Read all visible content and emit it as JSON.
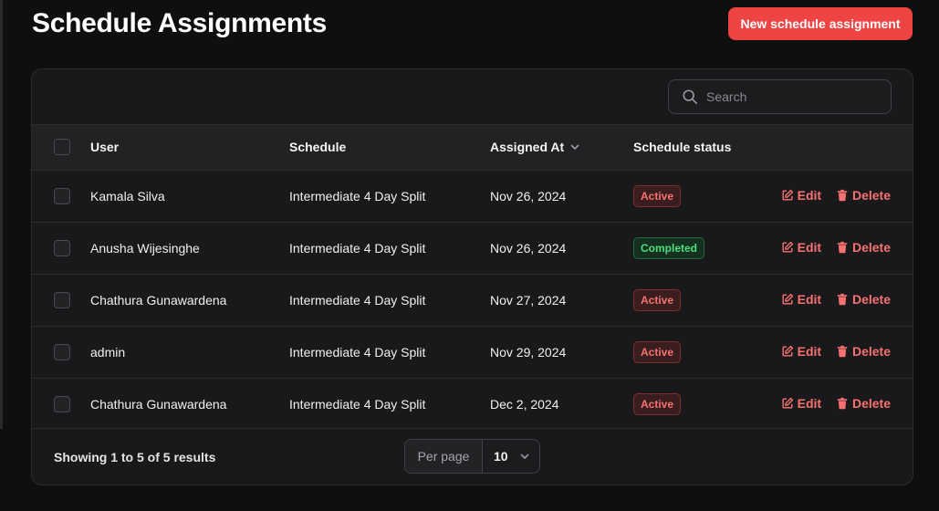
{
  "page": {
    "title": "Schedule Assignments",
    "new_button_label": "New schedule assignment"
  },
  "search": {
    "placeholder": "Search",
    "value": ""
  },
  "table": {
    "headers": {
      "user": "User",
      "schedule": "Schedule",
      "assigned_at": "Assigned At",
      "status": "Schedule status"
    },
    "rows": [
      {
        "user": "Kamala Silva",
        "schedule": "Intermediate 4 Day Split",
        "assigned_at": "Nov 26, 2024",
        "status": "Active",
        "edit": "Edit",
        "delete": "Delete"
      },
      {
        "user": "Anusha Wijesinghe",
        "schedule": "Intermediate 4 Day Split",
        "assigned_at": "Nov 26, 2024",
        "status": "Completed",
        "edit": "Edit",
        "delete": "Delete"
      },
      {
        "user": "Chathura Gunawardena",
        "schedule": "Intermediate 4 Day Split",
        "assigned_at": "Nov 27, 2024",
        "status": "Active",
        "edit": "Edit",
        "delete": "Delete"
      },
      {
        "user": "admin",
        "schedule": "Intermediate 4 Day Split",
        "assigned_at": "Nov 29, 2024",
        "status": "Active",
        "edit": "Edit",
        "delete": "Delete"
      },
      {
        "user": "Chathura Gunawardena",
        "schedule": "Intermediate 4 Day Split",
        "assigned_at": "Dec 2, 2024",
        "status": "Active",
        "edit": "Edit",
        "delete": "Delete"
      }
    ]
  },
  "footer": {
    "showing": "Showing 1 to 5 of 5 results",
    "per_page_label": "Per page",
    "per_page_value": "10"
  },
  "icons": {
    "search": "search-icon",
    "sort": "chevron-down-icon",
    "edit": "edit-icon",
    "delete": "trash-icon",
    "select": "chevron-down-icon"
  },
  "colors": {
    "accent": "#ef4444",
    "active_badge": "#f87171",
    "completed_badge": "#4ade80",
    "background": "#0f0f10",
    "card": "#19191b"
  }
}
